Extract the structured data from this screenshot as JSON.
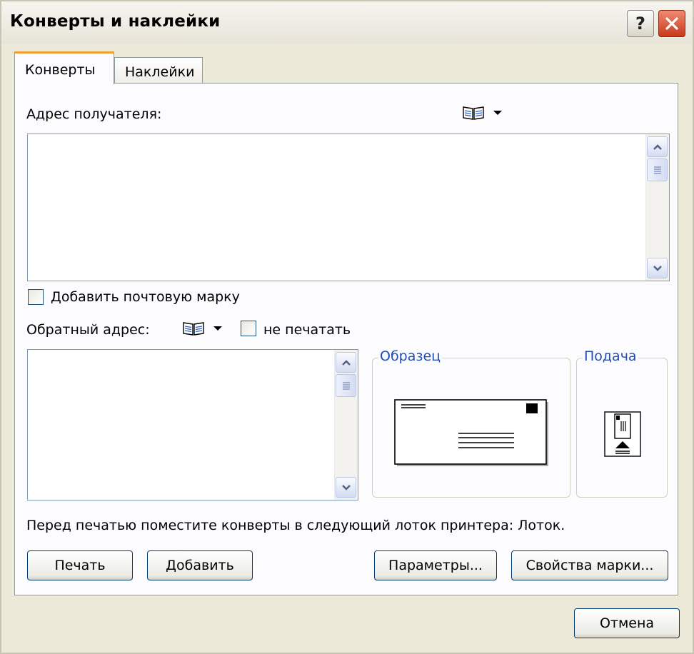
{
  "window": {
    "title": "Конверты и наклейки",
    "help_label": "?"
  },
  "tabs": [
    {
      "label": "Конверты",
      "active": true
    },
    {
      "label": "Наклейки",
      "active": false
    }
  ],
  "recipient": {
    "label": "Адрес получателя:",
    "value": ""
  },
  "postage": {
    "label": "Добавить почтовую марку",
    "checked": false
  },
  "return_address": {
    "label": "Обратный адрес:",
    "value": "",
    "omit_label": "не печатать",
    "omit_checked": false
  },
  "preview": {
    "title": "Образец"
  },
  "feed": {
    "title": "Подача"
  },
  "note": "Перед печатью поместите конверты в следующий лоток принтера: Лоток.",
  "buttons": {
    "print": "Печать",
    "add": "Добавить",
    "options": "Параметры...",
    "postage_props": "Свойства марки...",
    "cancel": "Отмена"
  },
  "colors": {
    "accent_tab": "#f0a030",
    "group_title": "#1f4db8",
    "close_button": "#c8391d"
  }
}
